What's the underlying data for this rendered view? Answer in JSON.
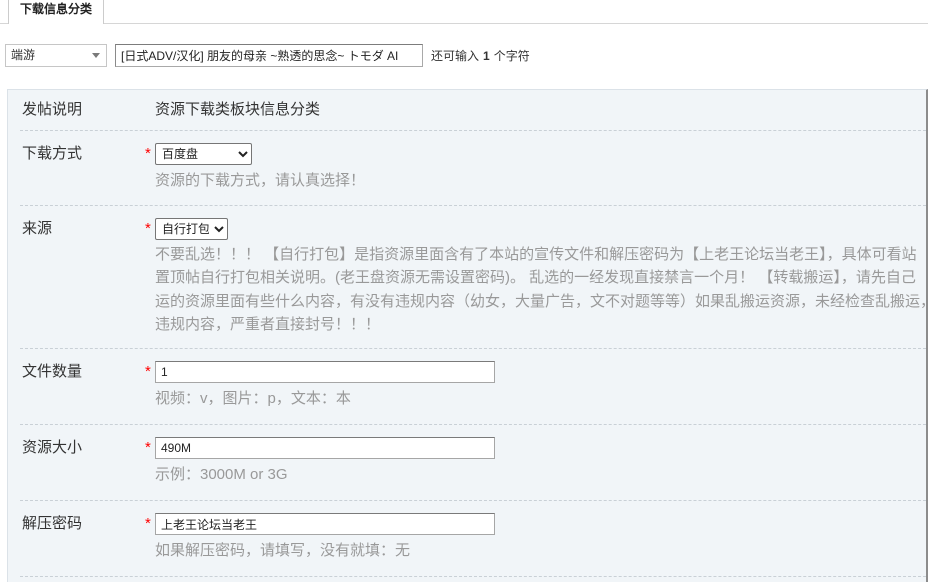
{
  "tabs": [
    {
      "label": "下载信息分类",
      "active": true
    }
  ],
  "title_row": {
    "category_select": {
      "value": "端游",
      "icon": "chevron-down-icon"
    },
    "title_input": {
      "value": "[日式ADV/汉化] 朋友的母亲 ~熟透的思念~ トモダ AI"
    },
    "char_counter": {
      "prefix": "还可输入",
      "count": "1",
      "suffix": "个字符"
    }
  },
  "form": {
    "required_mark": "*",
    "posting_note": {
      "label": "发帖说明",
      "value": "资源下载类板块信息分类"
    },
    "download_method": {
      "label": "下载方式",
      "selected": "百度盘",
      "hint": "资源的下载方式，请认真选择！"
    },
    "source": {
      "label": "来源",
      "selected": "自行打包",
      "hint_lines": [
        "不要乱选！！！ 【自行打包】是指资源里面含有了本站的宣传文件和解压密码为【上老王论坛当老王】，具体可看站",
        "置顶帖自行打包相关说明。(老王盘资源无需设置密码)。 乱选的一经发现直接禁言一个月！ 【转载搬运】，请先自己",
        "运的资源里面有些什么内容，有没有违规内容（幼女，大量广告，文不对题等等）如果乱搬运资源，未经检查乱搬运，",
        "违规内容，严重者直接封号！！！"
      ]
    },
    "file_count": {
      "label": "文件数量",
      "value": "1",
      "hint": "视频：v，图片：p，文本：本"
    },
    "resource_size": {
      "label": "资源大小",
      "value": "490M",
      "hint": "示例：3000M or 3G"
    },
    "unzip_password": {
      "label": "解压密码",
      "value": "上老王论坛当老王",
      "hint": "如果解压密码，请填写，没有就填：无"
    }
  },
  "colors": {
    "panel_background": "#f1f5f8",
    "required_mark": "#ff0000",
    "hint_text": "#999999",
    "label_text": "#333333"
  }
}
